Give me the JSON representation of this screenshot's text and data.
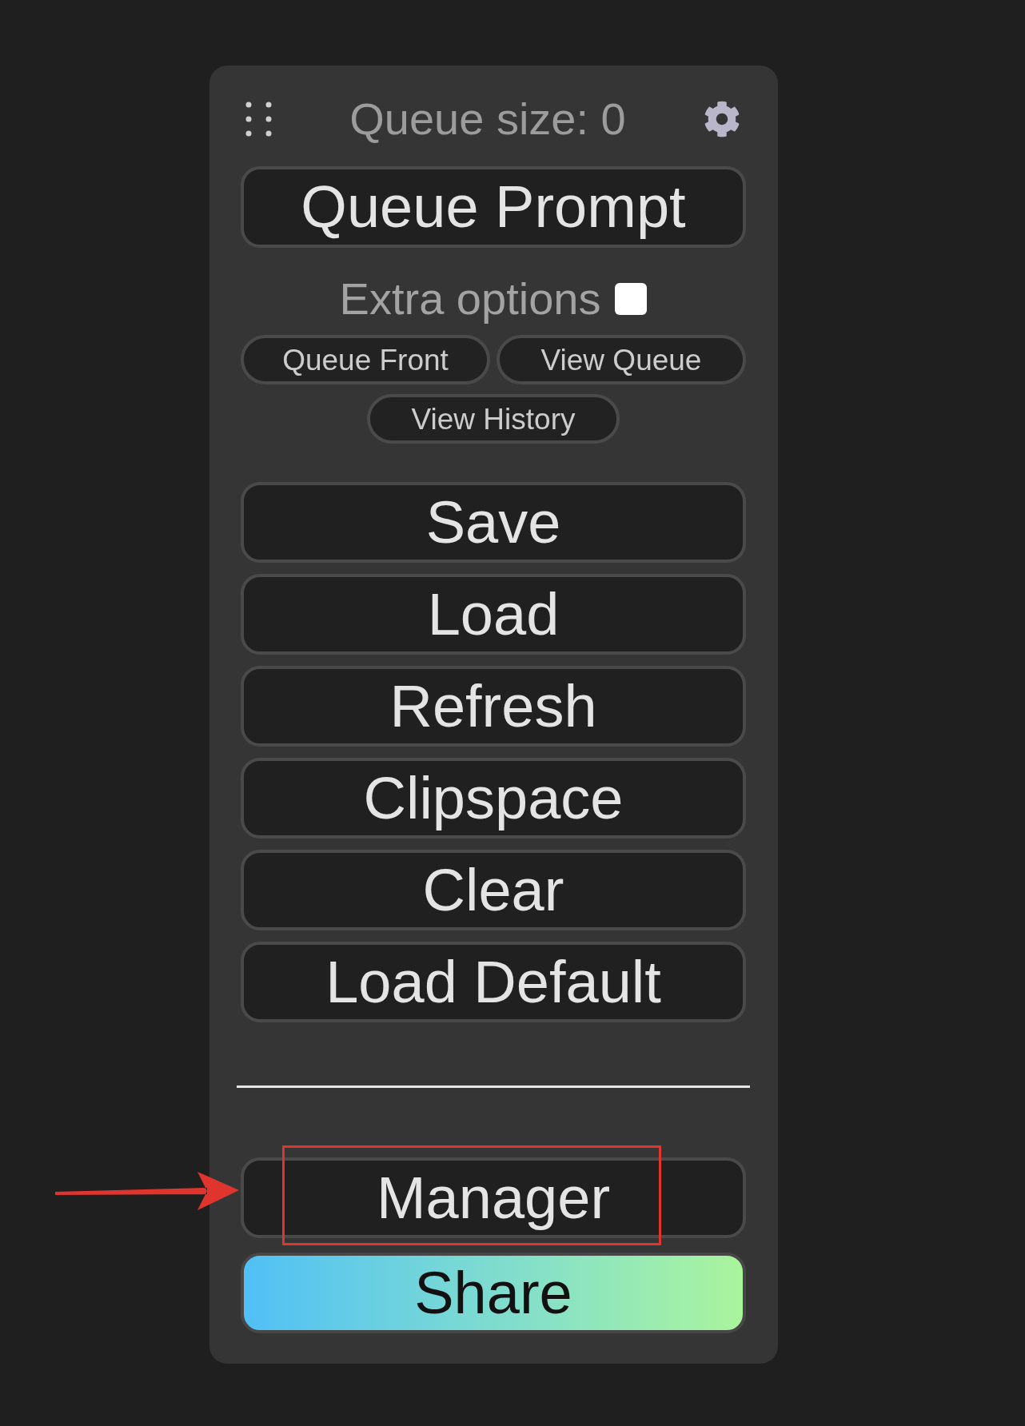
{
  "header": {
    "queue_size": "Queue size: 0"
  },
  "queue_button": "Queue Prompt",
  "extra_options": {
    "label": "Extra options",
    "checked": false
  },
  "extra_buttons": [
    "Queue Front",
    "View Queue",
    "View History"
  ],
  "menu_buttons": [
    "Save",
    "Load",
    "Refresh",
    "Clipspace",
    "Clear",
    "Load Default"
  ],
  "addon_buttons": [
    {
      "label": "Manager",
      "kind": "plain",
      "highlighted": true
    },
    {
      "label": "Share",
      "kind": "gradient",
      "highlighted": false
    }
  ]
}
